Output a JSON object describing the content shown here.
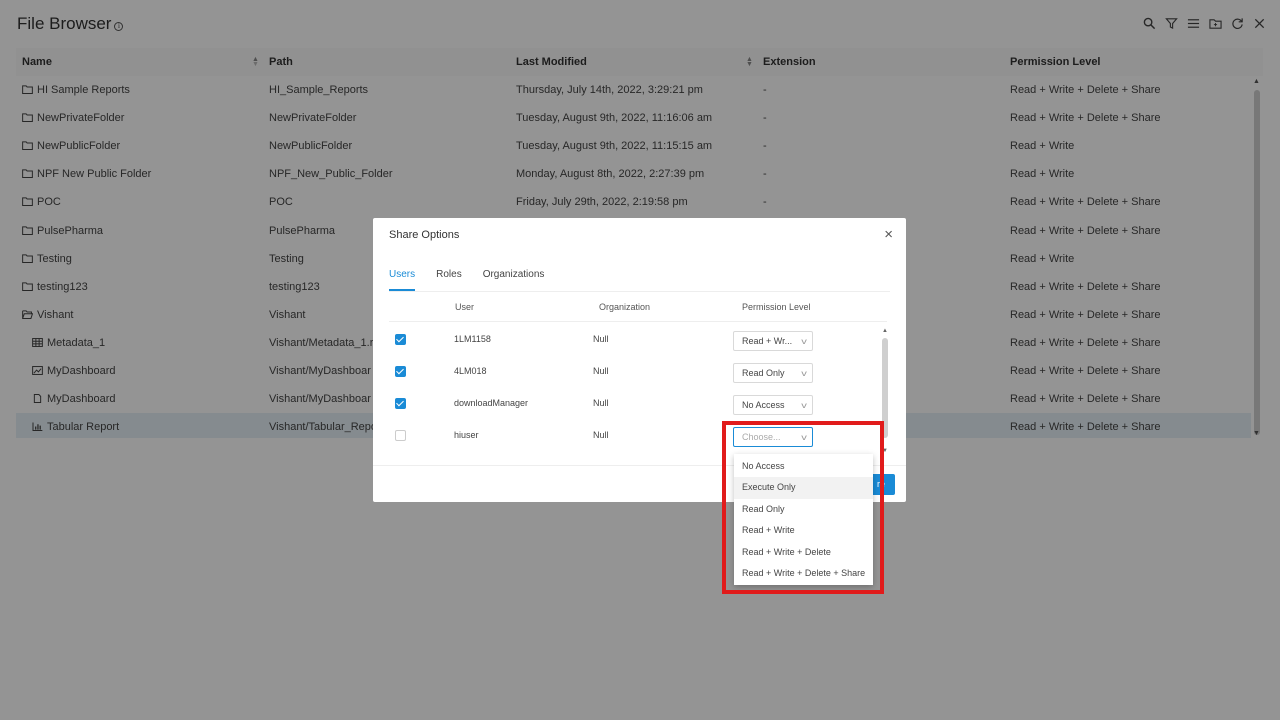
{
  "file_browser": {
    "title": "File Browser",
    "toolbar": {
      "search_icon": "search-icon",
      "filter_icon": "filter-icon",
      "menu_icon": "menu-icon",
      "folder_icon": "new-folder-icon",
      "refresh_icon": "refresh-icon",
      "close_icon": "close-icon"
    },
    "columns": [
      "Name",
      "Path",
      "Last Modified",
      "Extension",
      "Permission Level"
    ],
    "rows": [
      {
        "icon": "folder",
        "name": "HI Sample Reports",
        "path": "HI_Sample_Reports",
        "modified": "Thursday, July 14th, 2022, 3:29:21 pm",
        "extension": "-",
        "permission": "Read + Write + Delete + Share"
      },
      {
        "icon": "folder",
        "name": "NewPrivateFolder",
        "path": "NewPrivateFolder",
        "modified": "Tuesday, August 9th, 2022, 11:16:06 am",
        "extension": "-",
        "permission": "Read + Write + Delete + Share"
      },
      {
        "icon": "folder",
        "name": "NewPublicFolder",
        "path": "NewPublicFolder",
        "modified": "Tuesday, August 9th, 2022, 11:15:15 am",
        "extension": "-",
        "permission": "Read + Write"
      },
      {
        "icon": "folder",
        "name": "NPF New Public Folder",
        "path": "NPF_New_Public_Folder",
        "modified": "Monday, August 8th, 2022, 2:27:39 pm",
        "extension": "-",
        "permission": "Read + Write"
      },
      {
        "icon": "folder",
        "name": "POC",
        "path": "POC",
        "modified": "Friday, July 29th, 2022, 2:19:58 pm",
        "extension": "-",
        "permission": "Read + Write + Delete + Share"
      },
      {
        "icon": "folder",
        "name": "PulsePharma",
        "path": "PulsePharma",
        "modified": "",
        "extension": "",
        "permission": "Read + Write + Delete + Share"
      },
      {
        "icon": "folder",
        "name": "Testing",
        "path": "Testing",
        "modified": "",
        "extension": "",
        "permission": "Read + Write"
      },
      {
        "icon": "folder",
        "name": "testing123",
        "path": "testing123",
        "modified": "",
        "extension": "",
        "permission": "Read + Write + Delete + Share"
      },
      {
        "icon": "folder-open",
        "name": "Vishant",
        "path": "Vishant",
        "modified": "",
        "extension": "",
        "permission": "Read + Write + Delete + Share"
      },
      {
        "icon": "table",
        "name": "Metadata_1",
        "path": "Vishant/Metadata_1.r",
        "modified": "",
        "extension": "",
        "permission": "Read + Write + Delete + Share"
      },
      {
        "icon": "dashboard",
        "name": "MyDashboard",
        "path": "Vishant/MyDashboar",
        "modified": "",
        "extension": "",
        "permission": "Read + Write + Delete + Share"
      },
      {
        "icon": "file",
        "name": "MyDashboard",
        "path": "Vishant/MyDashboar",
        "modified": "",
        "extension": "",
        "permission": "Read + Write + Delete + Share"
      },
      {
        "icon": "chart",
        "name": "Tabular Report",
        "path": "Vishant/Tabular_Repo",
        "modified": "",
        "extension": "",
        "permission": "Read + Write + Delete + Share"
      }
    ]
  },
  "modal": {
    "title": "Share Options",
    "close": "×",
    "tabs": [
      "Users",
      "Roles",
      "Organizations"
    ],
    "active_tab": "Users",
    "headers": {
      "user": "User",
      "organization": "Organization",
      "permission": "Permission Level"
    },
    "users": [
      {
        "checked": true,
        "name": "1LM1158",
        "org": "Null",
        "permission": "Read + Wr..."
      },
      {
        "checked": true,
        "name": "4LM018",
        "org": "Null",
        "permission": "Read Only"
      },
      {
        "checked": true,
        "name": "downloadManager",
        "org": "Null",
        "permission": "No Access"
      },
      {
        "checked": false,
        "name": "hiuser",
        "org": "Null",
        "permission": "Choose..."
      }
    ],
    "share_button": "re"
  },
  "dropdown": {
    "options": [
      "No Access",
      "Execute Only",
      "Read Only",
      "Read + Write",
      "Read + Write + Delete",
      "Read + Write + Delete + Share"
    ],
    "hovered": "Execute Only"
  },
  "colors": {
    "accent": "#1a8bd6",
    "highlight": "#e11b1b",
    "selected_row": "#e6f0f6"
  }
}
